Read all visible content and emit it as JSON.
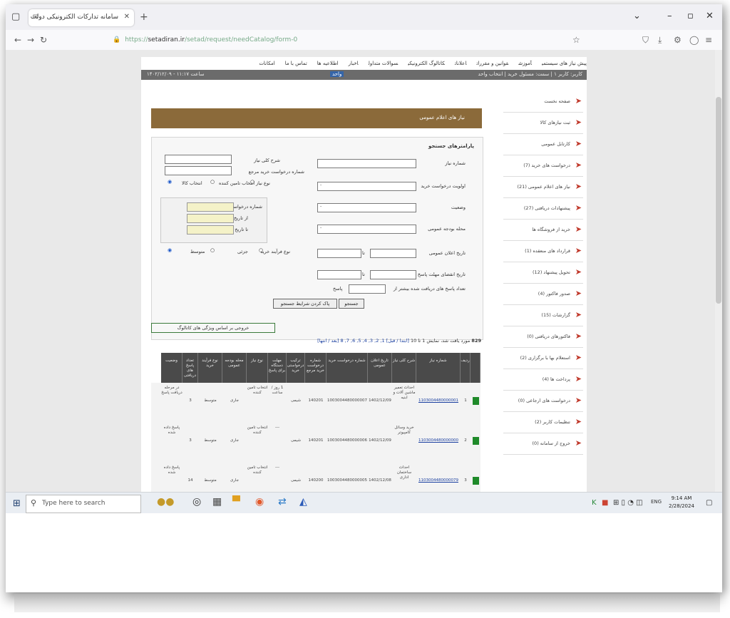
{
  "browser": {
    "tab_title": "سامانه تدارکات الکترونیکی دولت",
    "url_prefix": "https://",
    "url_host": "setadiran.ir",
    "url_path": "/setad/request/needCatalog/form-0"
  },
  "site": {
    "top_menu": [
      "پیش نیاز های سیستمی",
      "آموزش",
      "قوانین و مقررات",
      "اعلانات",
      "کاتالوگ الکترونیکی",
      "سوالات متداول",
      "اخبار",
      "اطلاعیه ها",
      "تماس با ما",
      "امکانات"
    ],
    "info_right": "کاربر: کاربر ۱ | سمت: مسئول خرید | انتخاب واحد",
    "info_mid": "واحد",
    "info_left": "۱۴۰۲/۱۲/۰۹ - ساعت ۱۱:۱۷"
  },
  "sidebar": [
    {
      "label": "صفحه نخست",
      "icon": "arrow-icon"
    },
    {
      "label": "ثبت نیازهای کالا",
      "icon": "arrow-icon"
    },
    {
      "label": "کارتابل عمومی",
      "icon": "arrow-icon"
    },
    {
      "label": "درخواست های خرید (7)",
      "icon": "arrow-icon"
    },
    {
      "label": "نیاز های اعلام عمومی (21)",
      "icon": "arrow-icon"
    },
    {
      "label": "پیشنهادات دریافتی (27)",
      "icon": "arrow-icon"
    },
    {
      "label": "خرید از فروشگاه ها",
      "icon": "arrow-icon"
    },
    {
      "label": "قرارداد های منعقده (1)",
      "icon": "arrow-icon"
    },
    {
      "label": "تحویل پیشنهاد (12)",
      "icon": "arrow-icon"
    },
    {
      "label": "صدور فاکتور (4)",
      "icon": "arrow-icon"
    },
    {
      "label": "گزارشات (15)",
      "icon": "arrow-icon"
    },
    {
      "label": "فاکتورهای دریافتی (0)",
      "icon": "arrow-icon"
    },
    {
      "label": "استعلام بها با برگزاری (2)",
      "icon": "arrow-icon"
    },
    {
      "label": "پرداخت ها (4)",
      "icon": "arrow-icon"
    },
    {
      "label": "درخواست های ارجاعی (0)",
      "icon": "arrow-icon"
    },
    {
      "label": "تنظیمات کاربر (2)",
      "icon": "arrow-icon"
    },
    {
      "label": "خروج از سامانه (0)",
      "icon": "arrow-icon"
    }
  ],
  "main": {
    "banner": "نیاز های اعلام عمومی",
    "search_title": "پارامترهای جستجو",
    "fields": {
      "need_number": "شماره نیاز",
      "priority": "اولویت درخواست خرید",
      "status": "وضعیت",
      "budget": "محله بودجه عمومی",
      "announce_date": "تاریخ اعلان عمومی",
      "deadline": "تاریخ انقضای مهلت پاسخ",
      "answers": "تعداد پاسخ های دریافت شده بیشتر از",
      "answers_unit": "پاسخ",
      "need_title": "شرح کلی نیاز",
      "request_num": "شماره درخواست خرید مرجع",
      "need_type": "نوع نیاز",
      "type_opt1": "انتخاب تامین کننده",
      "type_opt2": "انتخاب کالا",
      "request_no": "شماره درخواست",
      "from": "از تاریخ",
      "to": "تا تاریخ",
      "process": "نوع فرآیند خرید",
      "proc_opt1": "جزئی",
      "proc_opt2": "متوسط",
      "to_sep": "تا"
    },
    "search_button": "جستجو",
    "reset_button": "پاک کردن شرایط جستجو",
    "export_button": "خروجی بر اساس ویژگی های کاتالوگ",
    "results_count": "829",
    "results_text": "مورد یافت شد، نمایش 1 تا 10",
    "pager_prev": "[ابتدا / قبل]",
    "pager_pages": "1, 2, 3, 4, 5, 6, 7, 8",
    "pager_next": "[بعد / انتها]",
    "select_placeholder": "-"
  },
  "table": {
    "headers": [
      "ردیف",
      "شماره نیاز",
      "شرح کلی نیاز",
      "تاریخ اعلان عمومی",
      "شماره درخواست خرید",
      "شماره درخواست خرید مرجع",
      "ترکیب درخواستی خرید",
      "مهلت دستگاه برای پاسخ",
      "نوع نیاز",
      "محله بودجه عمومی",
      "نوع فرآیند خرید",
      "تعداد پاسخ های دریافتی",
      "وضعیت"
    ],
    "rows": [
      {
        "num": "1",
        "need": "1103004480000001",
        "desc": "احداث تعمیر ماشین آلات و ابنیه",
        "date": "1402/12/09",
        "req": "1003004480000007",
        "ref": "140201",
        "mix": "شیمی",
        "deadline": "1 روز / ساعت",
        "type": "انتخاب تامین کننده",
        "budget": "جاری",
        "process": "متوسط",
        "answers": "3",
        "status": "در مرحله دریافت پاسخ"
      },
      {
        "num": "2",
        "need": "1103004480000000",
        "desc": "خرید وسائل کامپیوتر",
        "date": "1402/12/09",
        "req": "1003004480000006",
        "ref": "140201",
        "mix": "شیمی",
        "deadline": "---",
        "type": "انتخاب تامین کننده",
        "budget": "جاری",
        "process": "متوسط",
        "answers": "3",
        "status": "پاسخ داده شده"
      },
      {
        "num": "3",
        "need": "1103004480000079",
        "desc": "احداث ساختمان اداری",
        "date": "1402/12/08",
        "req": "1003004480000005",
        "ref": "140200",
        "mix": "شیمی",
        "deadline": "---",
        "type": "انتخاب تامین کننده",
        "budget": "جاری",
        "process": "متوسط",
        "answers": "14",
        "status": "پاسخ داده شده"
      }
    ]
  },
  "taskbar": {
    "search_placeholder": "Type here to search",
    "time": "9:14 AM",
    "date": "2/28/2024",
    "lang": "ENG"
  }
}
